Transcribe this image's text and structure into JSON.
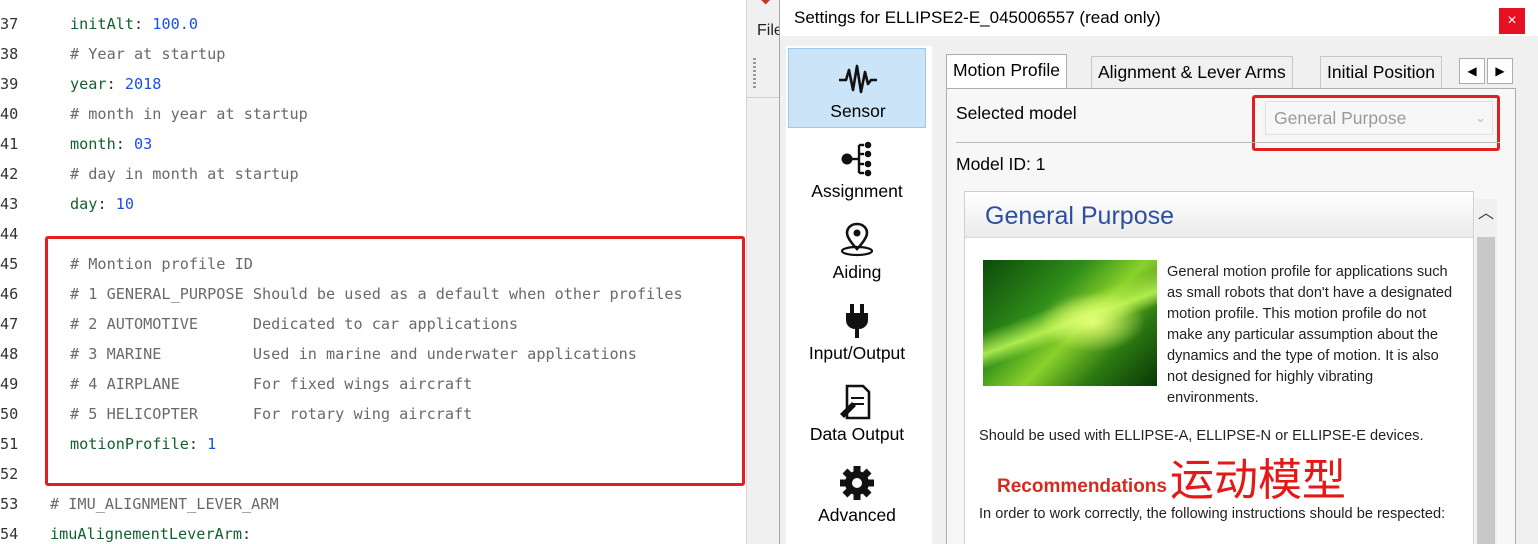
{
  "editor": {
    "lines": [
      {
        "n": "37",
        "key": "initAlt",
        "value": "100.0",
        "indent": 2
      },
      {
        "n": "38",
        "comment": "# Year at startup",
        "indent": 2
      },
      {
        "n": "39",
        "key": "year",
        "value": "2018",
        "indent": 2
      },
      {
        "n": "40",
        "comment": "# month in year at startup",
        "indent": 2
      },
      {
        "n": "41",
        "key": "month",
        "value": "03",
        "indent": 2
      },
      {
        "n": "42",
        "comment": "# day in month at startup",
        "indent": 2
      },
      {
        "n": "43",
        "key": "day",
        "value": "10",
        "indent": 2
      },
      {
        "n": "44",
        "indent": 0
      },
      {
        "n": "45",
        "comment": "# Montion profile ID",
        "indent": 2
      },
      {
        "n": "46",
        "comment": "# 1 GENERAL_PURPOSE Should be used as a default when other profiles",
        "indent": 2
      },
      {
        "n": "47",
        "comment": "# 2 AUTOMOTIVE      Dedicated to car applications",
        "indent": 2
      },
      {
        "n": "48",
        "comment": "# 3 MARINE          Used in marine and underwater applications",
        "indent": 2
      },
      {
        "n": "49",
        "comment": "# 4 AIRPLANE        For fixed wings aircraft",
        "indent": 2
      },
      {
        "n": "50",
        "comment": "# 5 HELICOPTER      For rotary wing aircraft",
        "indent": 2
      },
      {
        "n": "51",
        "key": "motionProfile",
        "value": "1",
        "indent": 2
      },
      {
        "n": "52",
        "indent": 0
      },
      {
        "n": "53",
        "comment": "# IMU_ALIGNMENT_LEVER_ARM",
        "indent": 0
      },
      {
        "n": "54",
        "key": "imuAlignementLeverArm",
        "value": "",
        "indent": 0
      }
    ]
  },
  "background_app": {
    "menu_label": "File"
  },
  "settings": {
    "title": "Settings for ELLIPSE2-E_045006557 (read only)",
    "close_glyph": "×",
    "sidebar": [
      {
        "label": "Sensor",
        "icon": "waveform-icon",
        "active": true
      },
      {
        "label": "Assignment",
        "icon": "tree-icon",
        "active": false
      },
      {
        "label": "Aiding",
        "icon": "satellite-pin-icon",
        "active": false
      },
      {
        "label": "Input/Output",
        "icon": "plug-icon",
        "active": false
      },
      {
        "label": "Data Output",
        "icon": "document-edit-icon",
        "active": false
      },
      {
        "label": "Advanced",
        "icon": "gear-icon",
        "active": false
      }
    ],
    "tabs": [
      {
        "label": "Motion Profile",
        "active": true
      },
      {
        "label": "Alignment & Lever Arms",
        "active": false
      },
      {
        "label": "Initial Position",
        "active": false
      }
    ],
    "tab_scroll_left": "◀",
    "tab_scroll_right": "▶",
    "selected_model_label": "Selected model",
    "selected_model_value": "General Purpose",
    "model_id_text": "Model ID: 1",
    "description": {
      "title": "General Purpose",
      "body": "General motion profile for applications such as small robots that don't have a designated motion profile. This motion profile do not make any particular assumption about the dynamics and the type of motion. It is also not designed for highly vibrating environments.",
      "usage": "Should be used with ELLIPSE-A, ELLIPSE-N or ELLIPSE-E devices.",
      "recommendations_title": "Recommendations",
      "recommendations_text": "In order to work correctly, the following instructions should be respected:"
    },
    "annotation_overlay": "运动模型"
  },
  "colors": {
    "highlight_red": "#e02020",
    "active_nav": "#cce4f7",
    "desc_title": "#2c4fa0",
    "recommendations": "#d32c1e"
  }
}
